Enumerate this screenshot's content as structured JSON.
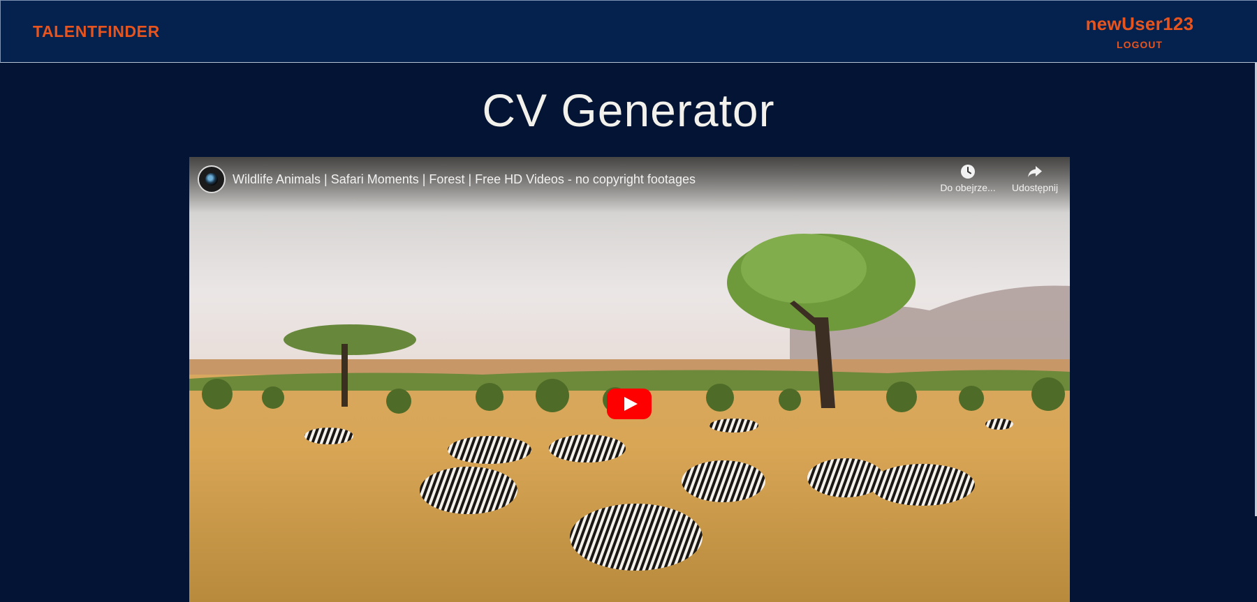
{
  "nav": {
    "brand": "TALENTFINDER",
    "username": "newUser123",
    "logout_label": "LOGOUT"
  },
  "page": {
    "title": "CV Generator"
  },
  "video": {
    "title": "Wildlife Animals | Safari Moments | Forest | Free HD Videos - no copyright footages",
    "watch_later_label": "Do obejrze...",
    "share_label": "Udostępnij",
    "icons": [
      "channel-avatar",
      "clock-icon",
      "share-arrow-icon",
      "play-icon"
    ]
  },
  "colors": {
    "page_bg": "#041434",
    "nav_bg": "#05224e",
    "accent": "#e8541d",
    "title_text": "#f3f1ec",
    "play_red": "#ff0000"
  }
}
